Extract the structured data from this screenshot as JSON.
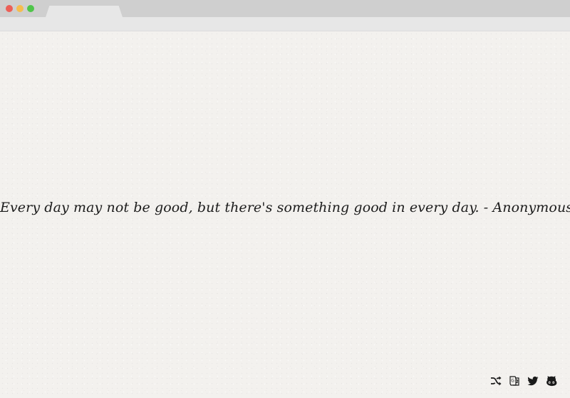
{
  "browser": {
    "dots": [
      {
        "name": "close",
        "color": "#ec5f57"
      },
      {
        "name": "minimize",
        "color": "#f5bd4f"
      },
      {
        "name": "zoom",
        "color": "#4fc54a"
      }
    ]
  },
  "quote": {
    "text": "Every day may not be good, but there's something good in every day. - Anonymous"
  },
  "icons": [
    {
      "name": "shuffle-icon"
    },
    {
      "name": "translate-icon"
    },
    {
      "name": "twitter-icon"
    },
    {
      "name": "github-icon"
    }
  ]
}
